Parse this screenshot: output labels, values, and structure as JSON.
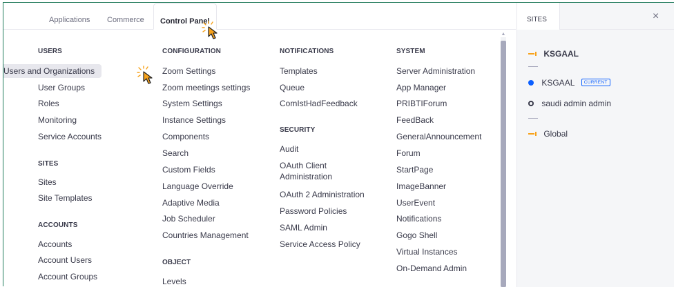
{
  "tabs": {
    "applications": "Applications",
    "commerce": "Commerce",
    "control_panel": "Control Panel"
  },
  "columns": {
    "users": {
      "title": "USERS",
      "items": [
        "Users and Organizations",
        "User Groups",
        "Roles",
        "Monitoring",
        "Service Accounts"
      ]
    },
    "sites": {
      "title": "SITES",
      "items": [
        "Sites",
        "Site Templates"
      ]
    },
    "accounts": {
      "title": "ACCOUNTS",
      "items": [
        "Accounts",
        "Account Users",
        "Account Groups"
      ]
    },
    "configuration": {
      "title": "CONFIGURATION",
      "items": [
        "Zoom Settings",
        "Zoom meetings settings",
        "System Settings",
        "Instance Settings",
        "Components",
        "Search",
        "Custom Fields",
        "Language Override",
        "Adaptive Media",
        "Job Scheduler",
        "Countries Management"
      ]
    },
    "object": {
      "title": "OBJECT",
      "items": [
        "Levels"
      ]
    },
    "notifications": {
      "title": "NOTIFICATIONS",
      "items": [
        "Templates",
        "Queue",
        "ComIstHadFeedback"
      ]
    },
    "security": {
      "title": "SECURITY",
      "items": [
        "Audit",
        "OAuth Client Administration",
        "OAuth 2 Administration",
        "Password Policies",
        "SAML Admin",
        "Service Access Policy"
      ]
    },
    "system": {
      "title": "SYSTEM",
      "items": [
        "Server Administration",
        "App Manager",
        "PRIBTIForum",
        "FeedBack",
        "GeneralAnnouncement",
        "Forum",
        "StartPage",
        "ImageBanner",
        "UserEvent",
        "Notifications",
        "Gogo Shell",
        "Virtual Instances",
        "On-Demand Admin"
      ]
    }
  },
  "sites_panel": {
    "tab_label": "SITES",
    "close_symbol": "×",
    "current_site": "KSGAAL",
    "list_site": "KSGAAL",
    "current_badge": "CURRENT",
    "admin_site": "saudi admin admin",
    "global": "Global"
  },
  "colors": {
    "accent": "#0b5fff",
    "cursor": "#f7a21b",
    "border": "#1f7a5a"
  },
  "icons": [
    "flag-icon",
    "circle-dot-icon",
    "ring-icon",
    "close-icon",
    "pointer-cursor-icon"
  ]
}
